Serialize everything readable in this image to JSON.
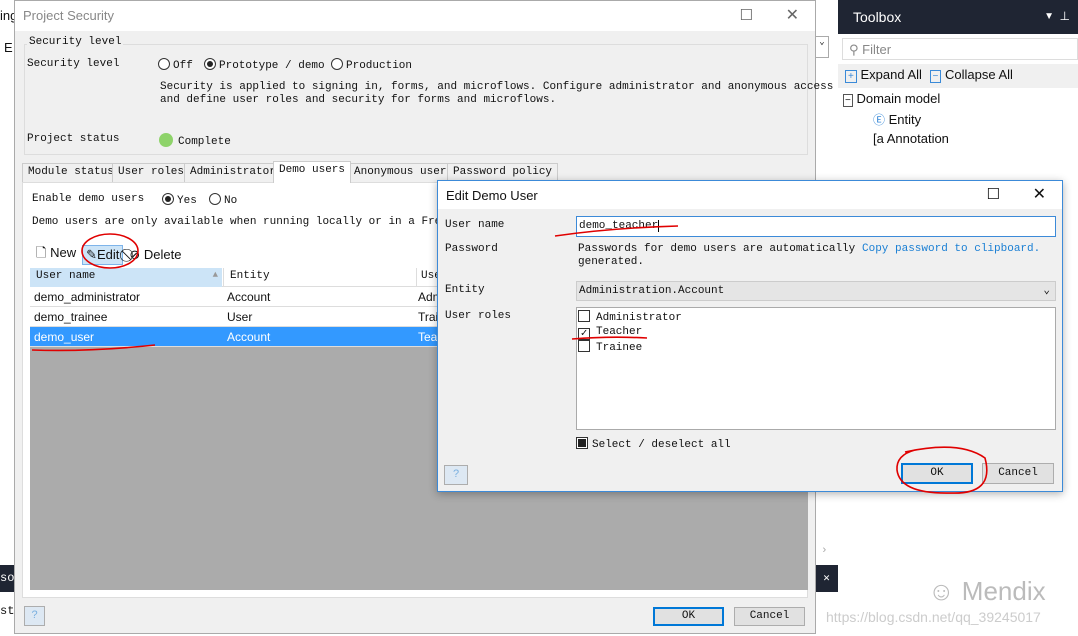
{
  "background": {
    "left_fragments": [
      "ing",
      "E",
      "sol",
      "sta"
    ]
  },
  "project_security": {
    "title": "Project Security",
    "group_label": "Security level",
    "security_level_label": "Security level",
    "levels": [
      {
        "label": "Off",
        "selected": false
      },
      {
        "label": "Prototype / demo",
        "selected": true
      },
      {
        "label": "Production",
        "selected": false
      }
    ],
    "description_line1": "Security is applied to signing in, forms, and microflows. Configure administrator and anonymous access",
    "description_line2": "and define user roles and security for forms and microflows.",
    "project_status_label": "Project status",
    "project_status": "Complete",
    "status_color": "#8ed36a",
    "tabs": [
      {
        "label": "Module status"
      },
      {
        "label": "User roles"
      },
      {
        "label": "Administrator"
      },
      {
        "label": "Demo users",
        "active": true
      },
      {
        "label": "Anonymous users"
      },
      {
        "label": "Password policy"
      }
    ],
    "enable_demo_label": "Enable demo users",
    "enable_yes": "Yes",
    "enable_no": "No",
    "demo_note": "Demo users are only available when running locally or in a Free App.",
    "toolbar": {
      "new": "New",
      "edit": "Edit",
      "delete": "Delete"
    },
    "columns": [
      "User name",
      "Entity",
      "User roles"
    ],
    "rows": [
      {
        "name": "demo_administrator",
        "entity": "Account",
        "roles": "Administrator"
      },
      {
        "name": "demo_trainee",
        "entity": "User",
        "roles": "Trainee"
      },
      {
        "name": "demo_user",
        "entity": "Account",
        "roles": "Teacher",
        "selected": true
      }
    ],
    "ok": "OK",
    "cancel": "Cancel",
    "help": "?"
  },
  "edit_demo_user": {
    "title": "Edit Demo User",
    "user_name_label": "User name",
    "user_name": "demo_teacher",
    "password_label": "Password",
    "password_note_line1": "Passwords for demo users are automatically",
    "password_note_line2": "generated.",
    "copy_link": "Copy password to clipboard.",
    "entity_label": "Entity",
    "entity": "Administration.Account",
    "user_roles_label": "User roles",
    "roles": [
      {
        "label": "Administrator",
        "checked": false
      },
      {
        "label": "Teacher",
        "checked": true
      },
      {
        "label": "Trainee",
        "checked": false
      }
    ],
    "select_all": "Select / deselect all",
    "ok": "OK",
    "cancel": "Cancel",
    "help": "?"
  },
  "toolbox": {
    "title": "Toolbox",
    "filter_placeholder": "Filter",
    "expand_all": "Expand All",
    "collapse_all": "Collapse All",
    "tree": {
      "group": "Domain model",
      "items": [
        {
          "label": "Entity",
          "icon": "entity-icon"
        },
        {
          "label": "Annotation",
          "icon": "annotation-icon"
        }
      ]
    }
  },
  "watermark": {
    "brand": "Mendix",
    "url": "https://blog.csdn.net/qq_39245017"
  },
  "colors": {
    "selection": "#3399ff",
    "accent": "#0078d7",
    "annotation": "#e00000",
    "toolbox_header": "#1f2533"
  }
}
